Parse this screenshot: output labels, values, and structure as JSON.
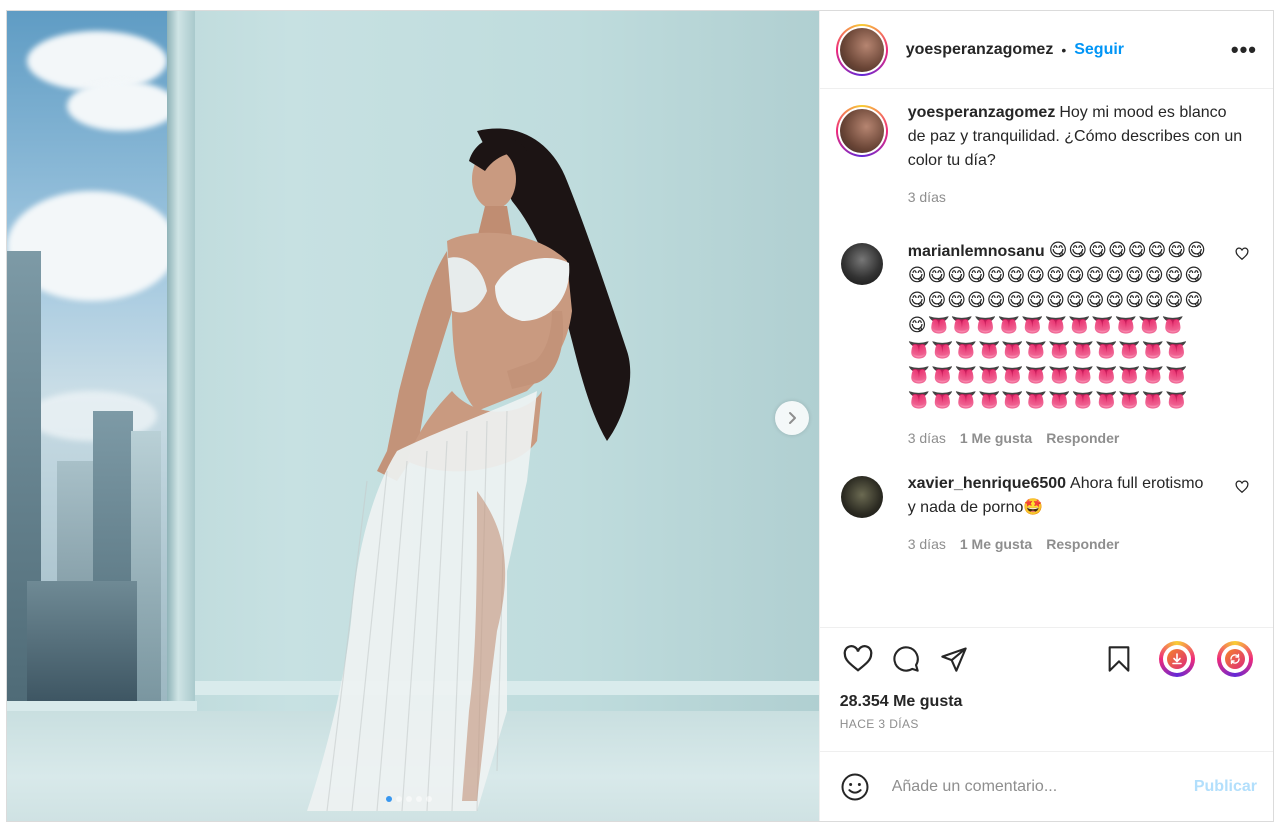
{
  "post": {
    "username": "yoesperanzagomez",
    "separator": "•",
    "follow_label": "Seguir",
    "more_label": "•••",
    "caption": "Hoy mi mood es blanco de paz y tranquilidad. ¿Cómo describes con un color tu día?",
    "caption_time": "3 días",
    "carousel": {
      "slides": 5,
      "active": 1
    }
  },
  "comments": [
    {
      "username": "marianlemnosanu",
      "text": "😋😋😋😋😋😋😋😋😋😋😋😋😋😋😋😋😋😋😋😋😋😋😋😋😋😋😋😋😋😋😋😋😋😋😋😋😋😋😋👅👅👅👅👅👅👅👅👅👅👅👅👅👅👅👅👅👅👅👅👅👅👅👅👅👅👅👅👅👅👅👅👅👅👅👅👅👅👅👅👅👅👅👅👅👅👅",
      "time": "3 días",
      "likes": "1 Me gusta",
      "reply": "Responder"
    },
    {
      "username": "xavier_henrique6500",
      "text": "Ahora full erotismo y nada de porno🤩",
      "time": "3 días",
      "likes": "1 Me gusta",
      "reply": "Responder"
    }
  ],
  "likes_count": "28.354 Me gusta",
  "posted_ago": "HACE 3 DÍAS",
  "composer": {
    "placeholder": "Añade un comentario...",
    "publish_label": "Publicar"
  },
  "icons": {
    "like": "heart-icon",
    "comment": "comment-icon",
    "share": "send-icon",
    "save": "bookmark-icon",
    "download": "download-icon",
    "repost": "repost-icon",
    "emoji": "emoji-icon",
    "next": "chevron-right-icon"
  },
  "colors": {
    "link": "#0095f6",
    "publish_disabled": "#b2dffc",
    "carousel_active": "#3897f0"
  }
}
